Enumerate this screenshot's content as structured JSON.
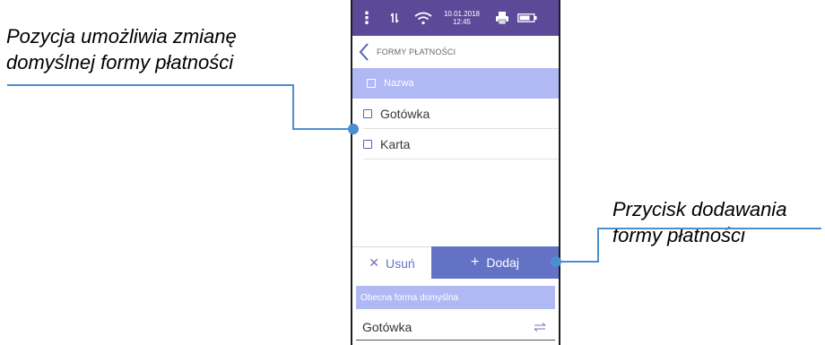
{
  "annotations": {
    "left": {
      "line1": "Pozycja umożliwia zmianę",
      "line2": "domyślnej formy płatności"
    },
    "right": {
      "line1": "Przycisk dodawania",
      "line2": "formy płatności"
    },
    "leader_color": "#4a8fd0"
  },
  "status_bar": {
    "date": "10.01.2018",
    "time": "12:45",
    "icons": [
      "menu-dots-icon",
      "signal-icon",
      "wifi-icon",
      "printer-icon",
      "battery-icon"
    ]
  },
  "nav": {
    "title": "FORMY PŁATNOŚCI",
    "back_icon": "chevron-left-icon"
  },
  "list": {
    "header_label": "Nazwa",
    "items": [
      {
        "label": "Gotówka"
      },
      {
        "label": "Karta"
      }
    ]
  },
  "actions": {
    "delete_label": "Usuń",
    "delete_icon": "close-icon",
    "add_label": "Dodaj",
    "add_icon": "plus-icon"
  },
  "default_payment": {
    "label": "Obecna forma domyślna",
    "value": "Gotówka",
    "change_icon": "swap-arrows-icon"
  },
  "colors": {
    "status_bar": "#5c4a99",
    "header_row": "#b0b9f3",
    "add_button": "#6472c6",
    "accent": "#6b72c2"
  }
}
